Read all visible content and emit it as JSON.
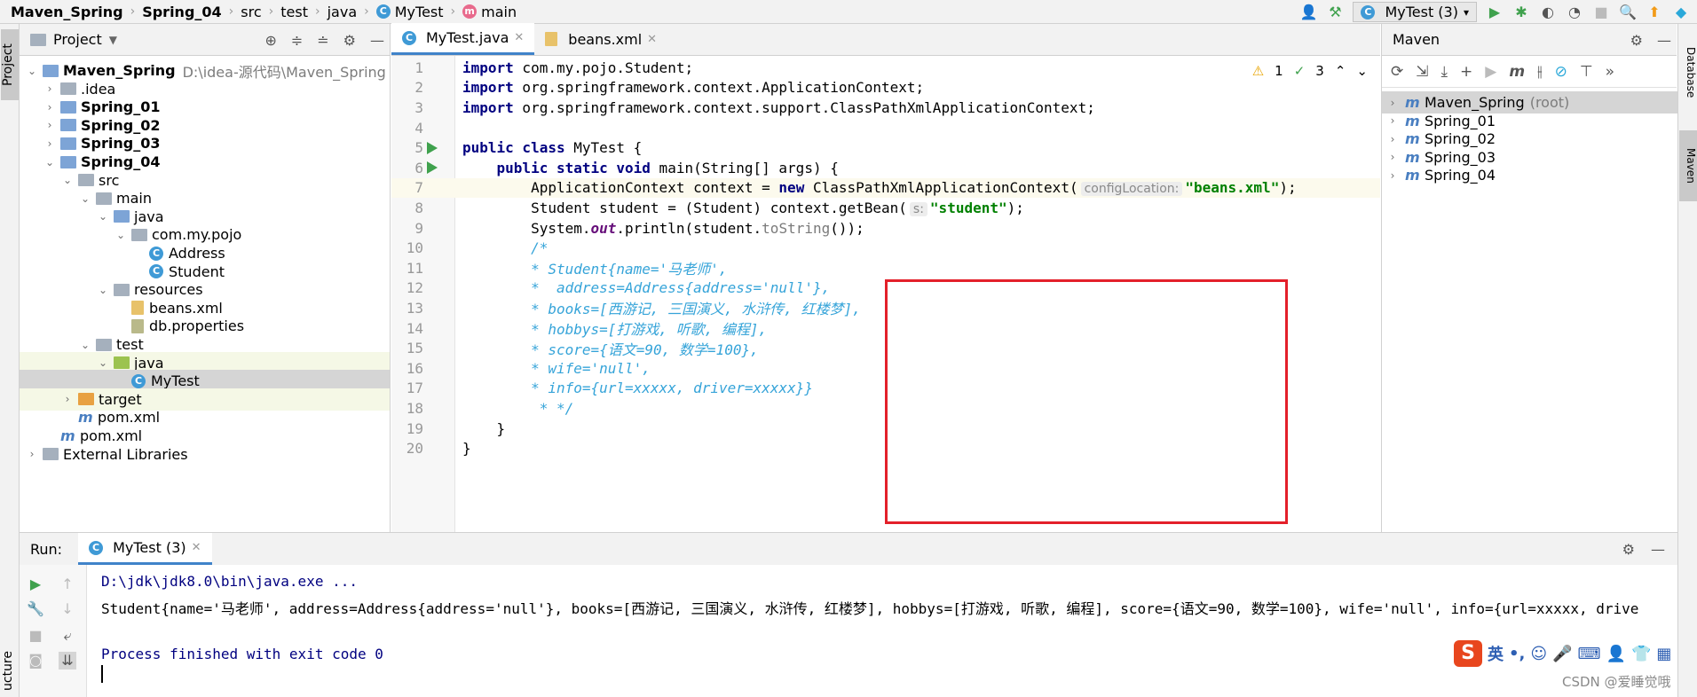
{
  "breadcrumb": [
    "Maven_Spring",
    "Spring_04",
    "src",
    "test",
    "java",
    "MyTest",
    "main"
  ],
  "run_config": "MyTest (3)",
  "left_strip": {
    "project_tab": "Project",
    "structure_tab": "ucture"
  },
  "project": {
    "title": "Project",
    "tree": [
      {
        "label": "Maven_Spring",
        "path": "D:\\idea-源代码\\Maven_Spring",
        "bold": true,
        "indent": 0,
        "arrow": "open",
        "icon": "folder-blue"
      },
      {
        "label": ".idea",
        "indent": 1,
        "arrow": "closed",
        "icon": "folder"
      },
      {
        "label": "Spring_01",
        "indent": 1,
        "arrow": "closed",
        "icon": "folder-blue",
        "bold": true
      },
      {
        "label": "Spring_02",
        "indent": 1,
        "arrow": "closed",
        "icon": "folder-blue",
        "bold": true
      },
      {
        "label": "Spring_03",
        "indent": 1,
        "arrow": "closed",
        "icon": "folder-blue",
        "bold": true
      },
      {
        "label": "Spring_04",
        "indent": 1,
        "arrow": "open",
        "icon": "folder-blue",
        "bold": true
      },
      {
        "label": "src",
        "indent": 2,
        "arrow": "open",
        "icon": "folder"
      },
      {
        "label": "main",
        "indent": 3,
        "arrow": "open",
        "icon": "folder"
      },
      {
        "label": "java",
        "indent": 4,
        "arrow": "open",
        "icon": "folder-blue"
      },
      {
        "label": "com.my.pojo",
        "indent": 5,
        "arrow": "open",
        "icon": "folder"
      },
      {
        "label": "Address",
        "indent": 6,
        "arrow": "none",
        "icon": "class"
      },
      {
        "label": "Student",
        "indent": 6,
        "arrow": "none",
        "icon": "class"
      },
      {
        "label": "resources",
        "indent": 4,
        "arrow": "open",
        "icon": "folder-res"
      },
      {
        "label": "beans.xml",
        "indent": 5,
        "arrow": "none",
        "icon": "xml"
      },
      {
        "label": "db.properties",
        "indent": 5,
        "arrow": "none",
        "icon": "props"
      },
      {
        "label": "test",
        "indent": 3,
        "arrow": "open",
        "icon": "folder"
      },
      {
        "label": "java",
        "indent": 4,
        "arrow": "open",
        "icon": "folder-green",
        "hl": true
      },
      {
        "label": "MyTest",
        "indent": 5,
        "arrow": "none",
        "icon": "class",
        "sel": true
      },
      {
        "label": "target",
        "indent": 2,
        "arrow": "closed",
        "icon": "folder-orange",
        "hl": true
      },
      {
        "label": "pom.xml",
        "indent": 2,
        "arrow": "none",
        "icon": "maven"
      },
      {
        "label": "pom.xml",
        "indent": 1,
        "arrow": "none",
        "icon": "maven"
      },
      {
        "label": "External Libraries",
        "indent": 0,
        "arrow": "closed",
        "icon": "lib"
      }
    ]
  },
  "editor": {
    "tabs": [
      {
        "label": "MyTest.java",
        "active": true
      },
      {
        "label": "beans.xml",
        "active": false
      }
    ],
    "warnings": "1",
    "checks": "3",
    "lines": [
      {
        "n": "1",
        "html": "<span class='kw'>import</span> com.my.pojo.Student;"
      },
      {
        "n": "2",
        "html": "<span class='kw'>import</span> org.springframework.context.ApplicationContext;"
      },
      {
        "n": "3",
        "html": "<span class='kw'>import</span> org.springframework.context.support.ClassPathXmlApplicationContext;"
      },
      {
        "n": "4",
        "html": ""
      },
      {
        "n": "5",
        "html": "<span class='kw'>public class</span> MyTest {",
        "run": true
      },
      {
        "n": "6",
        "html": "    <span class='kw'>public static void</span> main(String[] args) {",
        "run": true
      },
      {
        "n": "7",
        "html": "        ApplicationContext context = <span class='kw'>new</span> ClassPathXmlApplicationContext(<span class='hint'>configLocation:</span><span class='str'>\"beans.xml\"</span>);",
        "cur": true
      },
      {
        "n": "8",
        "html": "        Student student = (Student) context.getBean(<span class='hint'>s:</span><span class='str'>\"student\"</span>);"
      },
      {
        "n": "9",
        "html": "        System.<span class='fld'>out</span>.println(student.<span class='meth-gray'>toString</span>());"
      },
      {
        "n": "10",
        "html": "        <span class='cmt'>/*</span>"
      },
      {
        "n": "11",
        "html": "        <span class='cmt'>* Student{name='马老师',</span>"
      },
      {
        "n": "12",
        "html": "        <span class='cmt'>*  address=Address{address='null'},</span>"
      },
      {
        "n": "13",
        "html": "        <span class='cmt'>* books=[西游记, 三国演义, 水浒传, 红楼梦],</span>"
      },
      {
        "n": "14",
        "html": "        <span class='cmt'>* hobbys=[打游戏, 听歌, 编程],</span>"
      },
      {
        "n": "15",
        "html": "        <span class='cmt'>* score={语文=90, 数学=100},</span>"
      },
      {
        "n": "16",
        "html": "        <span class='cmt'>* wife='null',</span>"
      },
      {
        "n": "17",
        "html": "        <span class='cmt'>* info={url=xxxxx, driver=xxxxx}}</span>"
      },
      {
        "n": "18",
        "html": "         <span class='cmt'>* */</span>"
      },
      {
        "n": "19",
        "html": "    }"
      },
      {
        "n": "20",
        "html": "}"
      }
    ]
  },
  "maven": {
    "title": "Maven",
    "items": [
      {
        "label": "Maven_Spring",
        "suffix": "(root)",
        "sel": true
      },
      {
        "label": "Spring_01"
      },
      {
        "label": "Spring_02"
      },
      {
        "label": "Spring_03"
      },
      {
        "label": "Spring_04"
      }
    ],
    "right_tabs": [
      "Database",
      "Maven"
    ]
  },
  "run": {
    "label": "Run:",
    "tab": "MyTest (3)",
    "cmd": "D:\\jdk\\jdk8.0\\bin\\java.exe ...",
    "output": "Student{name='马老师', address=Address{address='null'}, books=[西游记, 三国演义, 水浒传, 红楼梦], hobbys=[打游戏, 听歌, 编程], score={语文=90, 数学=100}, wife='null', info={url=xxxxx, drive",
    "exit": "Process finished with exit code 0"
  },
  "ime": {
    "lang": "英"
  },
  "watermark": "CSDN @爱睡觉哦"
}
